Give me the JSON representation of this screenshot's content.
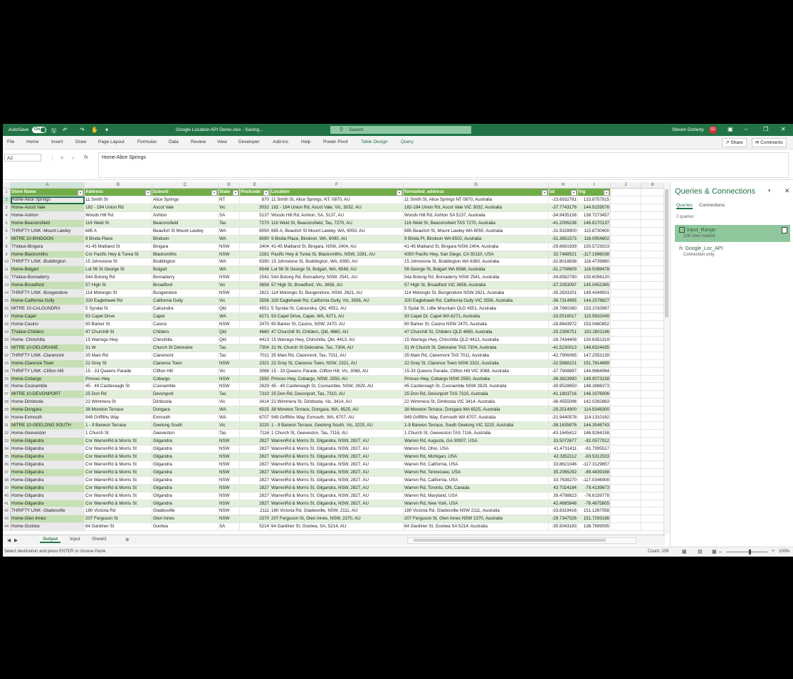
{
  "window": {
    "autosave_label": "AutoSave",
    "autosave_state": "On",
    "title": "Google Location API Demo.xlsx - Saving...",
    "search_placeholder": "Search",
    "user": "Steven Doherty",
    "user_initials": "SD",
    "accent": "#217346"
  },
  "menu": {
    "items": [
      "File",
      "Home",
      "Insert",
      "Draw",
      "Page Layout",
      "Formulas",
      "Data",
      "Review",
      "View",
      "Developer",
      "Add-ins",
      "Help",
      "Power Pivot",
      "Table Design",
      "Query"
    ],
    "share": "Share",
    "comments": "Comments"
  },
  "formula_bar": {
    "name_box": "A2",
    "fx": "fx",
    "value": "Home-Alice Springs"
  },
  "columns": [
    "A",
    "B",
    "C",
    "D",
    "E",
    "F",
    "G",
    "H",
    "I",
    "J",
    "K"
  ],
  "headers": [
    "Store Name",
    "Address",
    "Suburb",
    "State",
    "Postcode",
    "Location",
    "formatted_address",
    "lat",
    "lng"
  ],
  "rows": [
    [
      "Home-Alice Springs",
      "11 Smith St",
      "Alice Springs",
      "NT",
      "870",
      "11 Smith St, Alice Springs, NT, 0870, AU",
      "11 Smith St, Alice Springs NT 0870, Australia",
      "-23.6932781",
      "133.8757915"
    ],
    [
      "Home-Ascot Vale",
      "182 - 184 Union Rd",
      "Ascot Vale",
      "Vic",
      "3032",
      "182 - 184 Union Rd, Ascot Vale, Vic, 3032, AU",
      "182-184 Union Rd, Ascot Vale VIC 3032, Australia",
      "-37.7743176",
      "144.9159576"
    ],
    [
      "Home-Ashton",
      "Woods Hill Rd",
      "Ashton",
      "SA",
      "5137",
      "Woods Hill Rd, Ashton, SA, 5137, AU",
      "Woods Hill Rd, Ashton SA 5137, Australia",
      "-34.9435158",
      "138.7273457"
    ],
    [
      "Home-Beaconsfield",
      "116 Weld St",
      "Beaconsfield",
      "Tas",
      "7270",
      "116 Weld St, Beaconsfield, Tas, 7270, AU",
      "116 Weld St, Beaconsfield TAS 7270, Australia",
      "-41.2006238",
      "146.8170137"
    ],
    [
      "THRIFTY LINK -Mount Lawley",
      "685 A",
      "Beaufort St  Mount Lawley",
      "WA",
      "6050",
      "685 A, Beaufort St  Mount Lawley, WA, 6050, AU",
      "685 Beaufort St, Mount Lawley WA 6050, Australia",
      "-31.9328900",
      "115.8730400"
    ],
    [
      "MITRE 10-BINDOON",
      "9 Binda Place",
      "Bindoon",
      "WA",
      "6090",
      "9 Binda Place, Bindoon, WA, 6090, AU",
      "9 Binda Pl, Bindoon WA 6502, Australia",
      "-31.3851573",
      "116.0954802"
    ],
    [
      "T/Value-Bingara",
      "41-45 Maitland St",
      "Bingara",
      "NSW",
      "2404",
      "41-45 Maitland St, Bingara, NSW, 2404, AU",
      "41-45 Maitland St, Bingara NSW 2404, Australia",
      "-29.8691939",
      "150.5723023"
    ],
    [
      "Home-Blacksmiths",
      "Cnr Pacific Hwy & Turea St",
      "Blacksmiths",
      "NSW",
      "2281",
      "Pacific Hwy & Turea St, Blacksmiths, NSW, 2281, AU",
      "4350 Pacific Hwy, San Diego, CA 92110, USA",
      "32.7488521",
      "-117.1996038"
    ],
    [
      "THRIFTY LINK -Boddington",
      "15 Johnstone St",
      "Boddington",
      "WA",
      "6390",
      "15 Johnstone St, Boddington, WA, 6390, AU",
      "15 Johnstone St, Boddington WA 6390, Australia",
      "-32.8018838",
      "116.4739960"
    ],
    [
      "Home-Bolgart",
      "Lot 56 St George St",
      "Bolgart",
      "WA",
      "6548",
      "Lot 56 St George St, Bolgart, WA, 6548, AU",
      "56 George St, Bolgart WA 6568, Australia",
      "-31.2708609",
      "116.5098478"
    ],
    [
      "T/Value-Bomaderry",
      "54A Bolong Rd",
      "Bomaderry",
      "NSW",
      "2541",
      "54A Bolong Rd, Bomaderry, NSW, 2541, AU",
      "54a Bolong Rd, Bomaderry NSW 2541, Australia",
      "-34.8582790",
      "150.6056120"
    ],
    [
      "Home-Broadford",
      "57 High St",
      "Broadford",
      "Vic",
      "3658",
      "57 High St, Broadford, Vic, 3658, AU",
      "57 High St, Broadford VIC 3658, Australia",
      "-37.2053097",
      "145.0452365"
    ],
    [
      "THRIFTY LINK -Bungendore",
      "114 Molonglo St",
      "Bungendore",
      "NSW",
      "2621",
      "114 Molonglo St, Bungendore, NSW, 2621, AU",
      "114 Molonglo St, Bungendore NSW 2621, Australia",
      "-35.2633201",
      "149.4344501"
    ],
    [
      "Home-California Gully",
      "320 Eaglehawk Rd",
      "California Gully",
      "Vic",
      "3556",
      "320 Eaglehawk Rd, California Gully, Vic, 3556, AU",
      "320 Eaglehawk Rd, California Gully VIC 3556, Australia",
      "-36.7314995",
      "144.2578827"
    ],
    [
      "MITRE 10-CALOUNDRA",
      "5 Syndal St",
      "Caloundra",
      "Qld",
      "4551",
      "5 Syndal St, Caloundra, Qld, 4551, AU",
      "5 Sydal St, Little Mountain QLD 4551, Australia",
      "-26.7960260",
      "153.1033987"
    ],
    [
      "Home-Capel",
      "93 Capel Drive",
      "Capel",
      "WA",
      "6271",
      "93 Capel Drive, Capel, WA, 6271, AU",
      "93 Capel Dr, Capel WA 6271, Australia",
      "-33.5516017",
      "115.5632049"
    ],
    [
      "Home-Casino",
      "90 Barker St",
      "Casino",
      "NSW",
      "2470",
      "90 Barker St, Casino, NSW, 2470, AU",
      "90 Barker St, Casino NSW 2470, Australia",
      "-28.8643972",
      "153.0460852"
    ],
    [
      "T/Value-Childers",
      "47 Churchill St",
      "Childers",
      "Qld",
      "4660",
      "47 Churchill St, Childers, Qld, 4660, AU",
      "47 Churchill St, Childers QLD 4660, Australia",
      "-25.2356751",
      "152.2801196"
    ],
    [
      "Home- Chinchilla",
      "15 Warrego Hwy",
      "Chinchilla",
      "Qld",
      "4413",
      "15 Warrego Hwy, Chinchilla, Qld, 4413, AU",
      "15 Warrego Hwy, Chinchilla QLD 4413, Australia",
      "-26.7434408",
      "150.6351319"
    ],
    [
      "MITRE 10-DELORAINE",
      "31 W",
      "Church St  Deloraine",
      "Tas",
      "7304",
      "31 W, Church St  Deloraine, Tas, 7304, AU",
      "31 W Church St, Deloraine TAS 7304, Australia",
      "-41.5230013",
      "146.6524435"
    ],
    [
      "THRIFTY LINK -Claremont",
      "35 Main Rd",
      "Claremont",
      "Tas",
      "7011",
      "35 Main Rd, Claremont, Tas, 7011, AU",
      "35 Main Rd, Claremont TAS 7011, Australia",
      "-42.7906065",
      "147.2553139"
    ],
    [
      "Home-Clarence Town",
      "22 Grey St",
      "Clarence Town",
      "NSW",
      "2321",
      "22 Grey St, Clarence Town, NSW, 2321, AU",
      "22 Grey St, Clarence Town NSW 2321, Australia",
      "-32.5888221",
      "151.7814889"
    ],
    [
      "THRIFTY LINK -Clifton Hill",
      "15 - 33 Queens Parade",
      "Clifton Hill",
      "Vic",
      "3068",
      "15 - 33 Queens Parade, Clifton Hill, Vic, 3068, AU",
      "15-33 Queens Parade, Clifton Hill VIC 3068, Australia",
      "-37.7908897",
      "144.9864064"
    ],
    [
      "Home-Cobargo",
      "Princes Hwy",
      "Cobargo",
      "NSW",
      "2550",
      "Princes Hwy, Cobargo, NSW, 2550, AU",
      "Princes Hwy, Cobargo NSW 2550, Australia",
      "-36.3823990",
      "149.9073158"
    ],
    [
      "Home-Coonamble",
      "45 - 49 Castlereagh St",
      "Coonamble",
      "NSW",
      "2829",
      "45 - 49 Castlereagh St, Coonamble, NSW, 2829, AU",
      "45 Castlereagh St, Coonamble NSW 2829, Australia",
      "-30.9528650",
      "148.3888373"
    ],
    [
      "MITRE 10-DEVONPORT",
      "25 Don Rd",
      "Devonport",
      "Tas",
      "7310",
      "25 Don Rd, Devonport, Tas, 7310, AU",
      "25 Don Rd, Devonport TAS 7310, Australia",
      "-41.1803716",
      "146.3376006"
    ],
    [
      "Home-Dimboola",
      "22 Wimmera St",
      "Dimboola",
      "Vic",
      "3414",
      "22 Wimmera St, Dimboola, Vic, 3414, AU",
      "22 Wimmera St, Dimboola VIC 3414, Australia",
      "-36.4555096",
      "142.0282863"
    ],
    [
      "Home-Dongara",
      "38 Moreton Terrace",
      "Dongara",
      "WA",
      "6525",
      "38 Moreton Terrace, Dongara, WA, 6525, AU",
      "38 Moreton Terrace, Dongara WA 6525, Australia",
      "-29.2514900",
      "114.9348300"
    ],
    [
      "Home-Exmouth",
      "949 Griffiths Way",
      "Exmouth",
      "WA",
      "6707",
      "949 Griffiths Way, Exmouth, WA, 6707, AU",
      "949 Griffiths Way, Exmouth WA 6707, Australia",
      "-21.9440578",
      "114.1310182"
    ],
    [
      "MITRE 10-GEELONG SOUTH",
      "1 - 9 Barwon Terrace",
      "Geelong South",
      "Vic",
      "3220",
      "1 - 9 Barwon Terrace, Geelong South, Vic, 3220, AU",
      "1-9 Barwon Terrace, South Geelong VIC 3220, Australia",
      "-38.1635876",
      "144.3548743"
    ],
    [
      "Home-Geeveston",
      "1 Church St",
      "Geeveston",
      "Tas",
      "7116",
      "1 Church St, Geeveston, Tas, 7116, AU",
      "1 Church St, Geeveston TAS 7116, Australia",
      "-43.1645412",
      "146.9264158"
    ],
    [
      "Home-Gilgandra",
      "Cnr WarrenRd & Morris St",
      "Gilgandra",
      "NSW",
      "2827",
      "WarrenRd & Morris St, Gilgandra, NSW, 2827, AU",
      "Warren Rd, Augusta, GA 30907, USA",
      "33.5072677",
      "-82.0577912"
    ],
    [
      "Home-Gilgandra",
      "Cnr WarrenRd & Morris St",
      "Gilgandra",
      "NSW",
      "2827",
      "WarrenRd & Morris St, Gilgandra, NSW, 2827, AU",
      "Warren Rd, Ohio, USA",
      "41.4731411",
      "-81.7995517"
    ],
    [
      "Home-Gilgandra",
      "Cnr WarrenRd & Morris St",
      "Gilgandra",
      "NSW",
      "2827",
      "WarrenRd & Morris St, Gilgandra, NSW, 2827, AU",
      "Warren Rd, Michigan, USA",
      "42.3352112",
      "-83.5312533"
    ],
    [
      "Home-Gilgandra",
      "Cnr WarrenRd & Morris St",
      "Gilgandra",
      "NSW",
      "2827",
      "WarrenRd & Morris St, Gilgandra, NSW, 2827, AU",
      "Warren Rd, California, USA",
      "33.8621046",
      "-117.3129657"
    ],
    [
      "Home-Gilgandra",
      "Cnr WarrenRd & Morris St",
      "Gilgandra",
      "NSW",
      "2827",
      "WarrenRd & Morris St, Gilgandra, NSW, 2827, AU",
      "Warren Rd, Tennessee, USA",
      "35.2065292",
      "-89.4439168"
    ],
    [
      "Home-Gilgandra",
      "Cnr WarrenRd & Morris St",
      "Gilgandra",
      "NSW",
      "2827",
      "WarrenRd & Morris St, Gilgandra, NSW, 2827, AU",
      "Warren Rd, California, USA",
      "33.7638270",
      "-117.0346908"
    ],
    [
      "Home-Gilgandra",
      "Cnr WarrenRd & Morris St",
      "Gilgandra",
      "NSW",
      "2827",
      "WarrenRd & Morris St, Gilgandra, NSW, 2827, AU",
      "Warren Rd, Toronto, ON, Canada",
      "43.7024184",
      "-79.4139673"
    ],
    [
      "Home-Gilgandra",
      "Cnr WarrenRd & Morris St",
      "Gilgandra",
      "NSW",
      "2827",
      "WarrenRd & Morris St, Gilgandra, NSW, 2827, AU",
      "Warren Rd, Maryland, USA",
      "39.4798623",
      "-76.6159778"
    ],
    [
      "Home-Gilgandra",
      "Cnr WarrenRd & Morris St",
      "Gilgandra",
      "NSW",
      "2827",
      "WarrenRd & Morris St, Gilgandra, NSW, 2827, AU",
      "Warren Rd, New York, USA",
      "42.4885848",
      "-76.4675805"
    ],
    [
      "THRIFTY LINK -Gladesville",
      "180 Victoria Rd",
      "Gladesville",
      "NSW",
      "2111",
      "180 Victoria Rd, Gladesville, NSW, 2111, AU",
      "180 Victoria Rd, Gladesville NSW 2111, Australia",
      "-33.8319416",
      "151.1267058"
    ],
    [
      "Home-Glen Innes",
      "207 Ferguson St",
      "Glen Innes",
      "NSW",
      "2370",
      "207 Ferguson St, Glen Innes, NSW, 2370, AU",
      "207 Ferguson St, Glen Innes NSW 2370, Australia",
      "-29.7347526",
      "151.7293186"
    ],
    [
      "Home-Goolwa",
      "64 Gardiner St",
      "Goolwa",
      "SA",
      "5214",
      "64 Gardiner St, Goolwa, SA, 5214, AU",
      "64 Gardiner St, Goolwa SA 5214, Australia",
      "-35.5043183",
      "138.7699095"
    ]
  ],
  "sheet_tabs": [
    "Output",
    "Input",
    "Sheet3"
  ],
  "status": {
    "message": "Select destination and press ENTER or choose Paste",
    "count": "Count: 109",
    "zoom": "100%"
  },
  "queries_pane": {
    "title": "Queries & Connections",
    "tabs": [
      "Queries",
      "Connections"
    ],
    "count_text": "2 queries",
    "items": [
      {
        "name": "Input_Range",
        "sub": "109 rows loaded."
      },
      {
        "name": "Google_Loc_API",
        "sub": "Connection only."
      }
    ]
  }
}
